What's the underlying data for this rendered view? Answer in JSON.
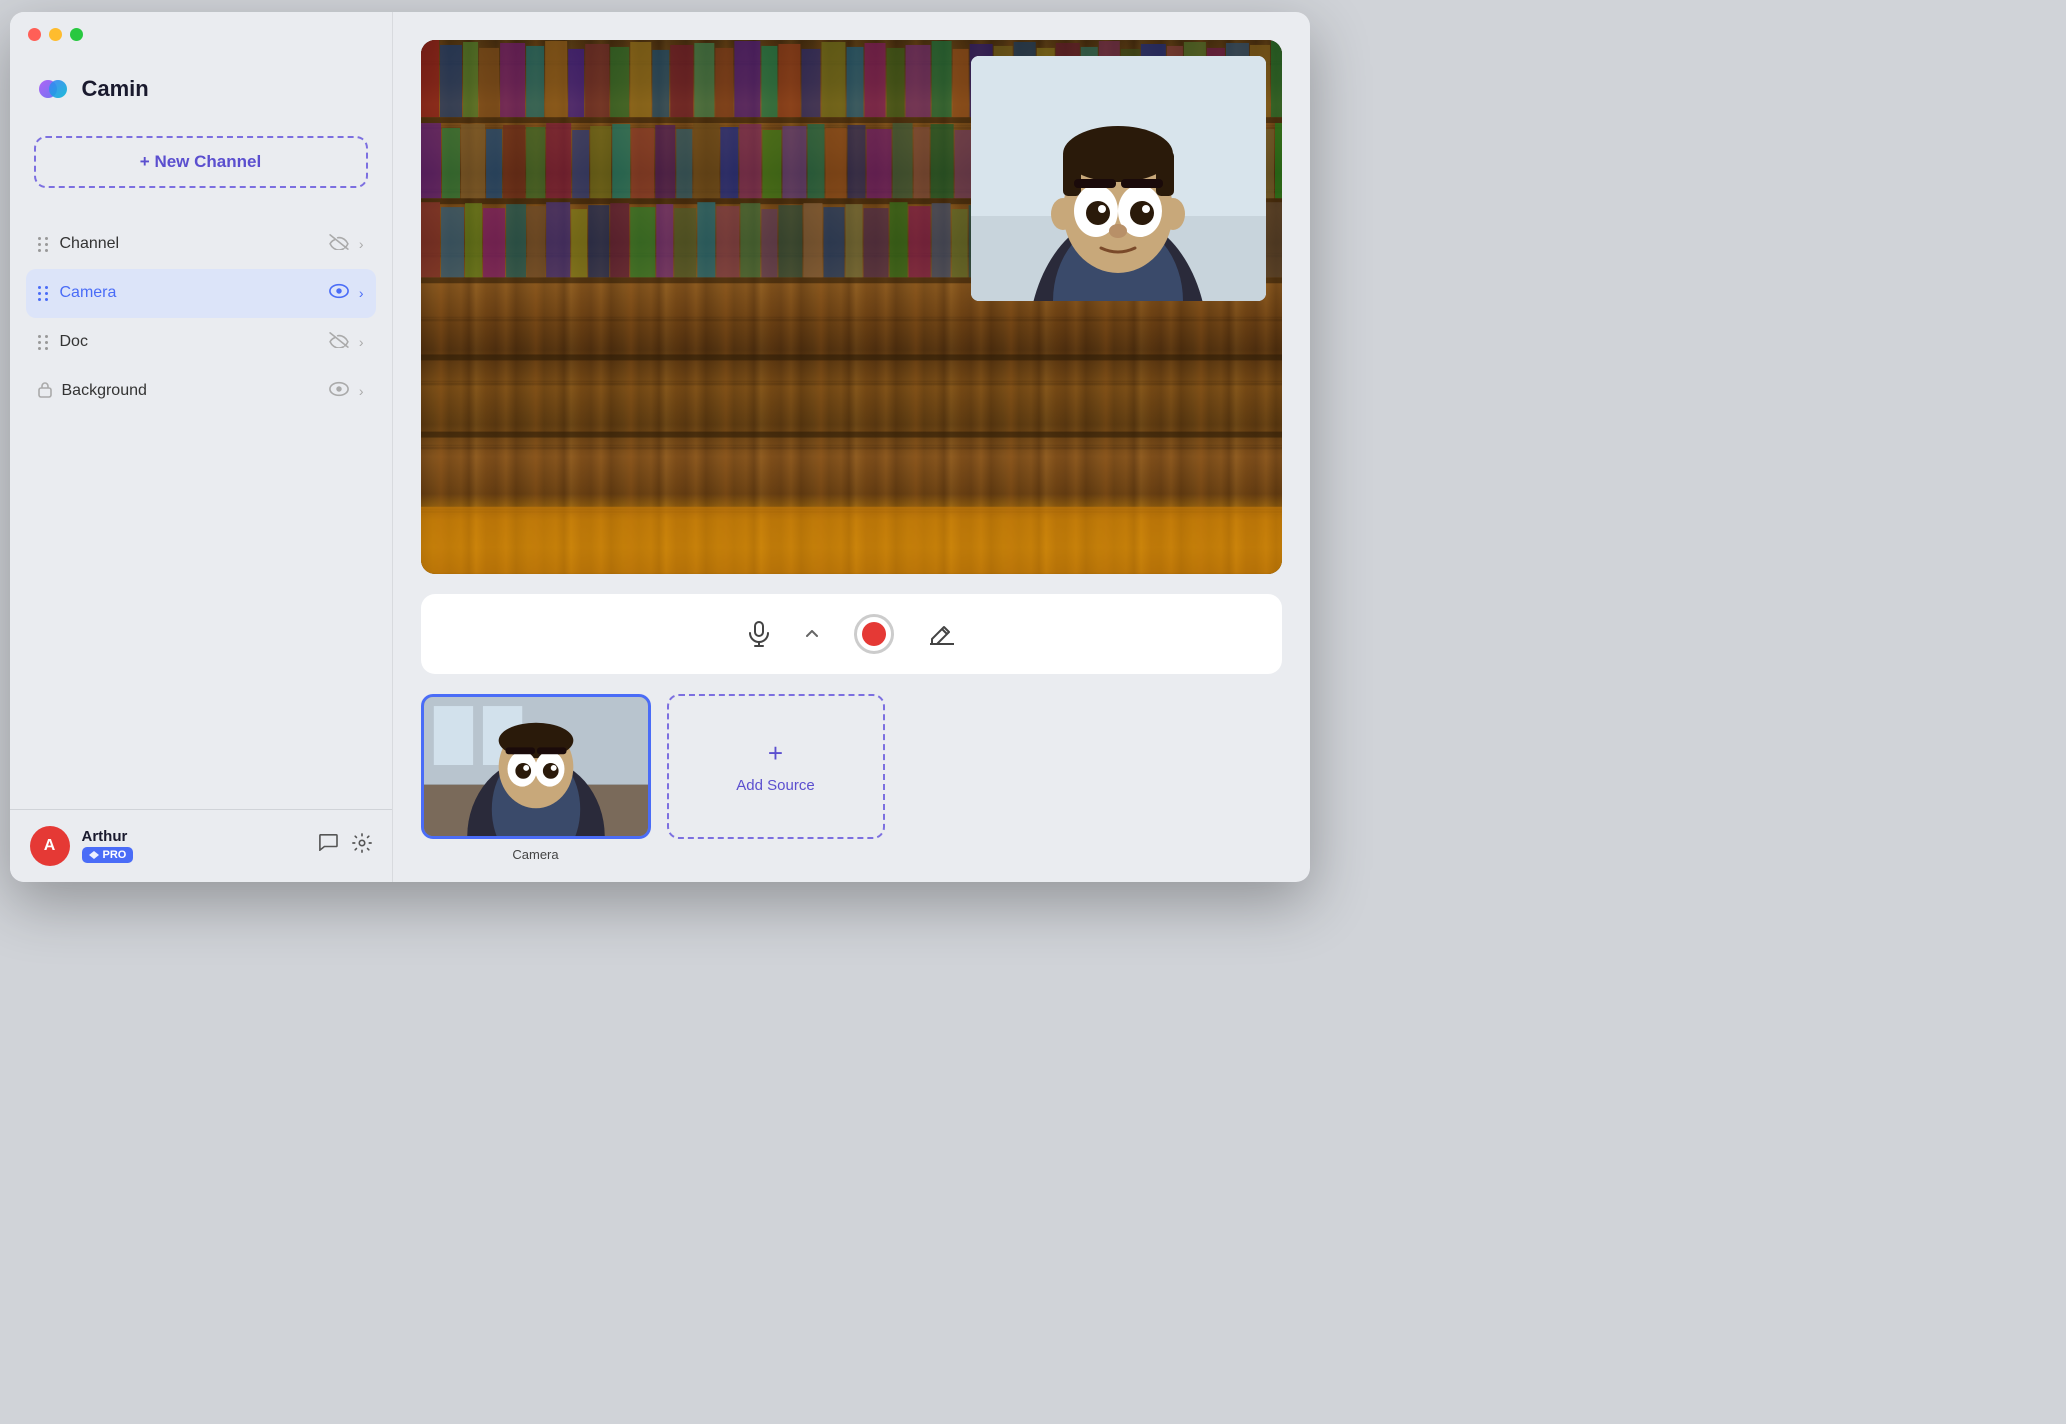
{
  "window": {
    "title": "Camin"
  },
  "sidebar": {
    "logo_text": "Camin",
    "new_channel_label": "+ New Channel",
    "channels": [
      {
        "id": "channel",
        "label": "Channel",
        "active": false,
        "locked": false
      },
      {
        "id": "camera",
        "label": "Camera",
        "active": true,
        "locked": false
      },
      {
        "id": "doc",
        "label": "Doc",
        "active": false,
        "locked": false
      },
      {
        "id": "background",
        "label": "Background",
        "active": false,
        "locked": true
      }
    ],
    "user": {
      "name": "Arthur",
      "badge": "PRO",
      "avatar_letter": "A"
    }
  },
  "main": {
    "controls": {
      "mic_label": "Microphone",
      "record_label": "Record",
      "annotate_label": "Annotate"
    },
    "sources": [
      {
        "id": "camera",
        "label": "Camera",
        "selected": true
      }
    ],
    "add_source_label": "Add Source",
    "add_source_icon": "+"
  }
}
